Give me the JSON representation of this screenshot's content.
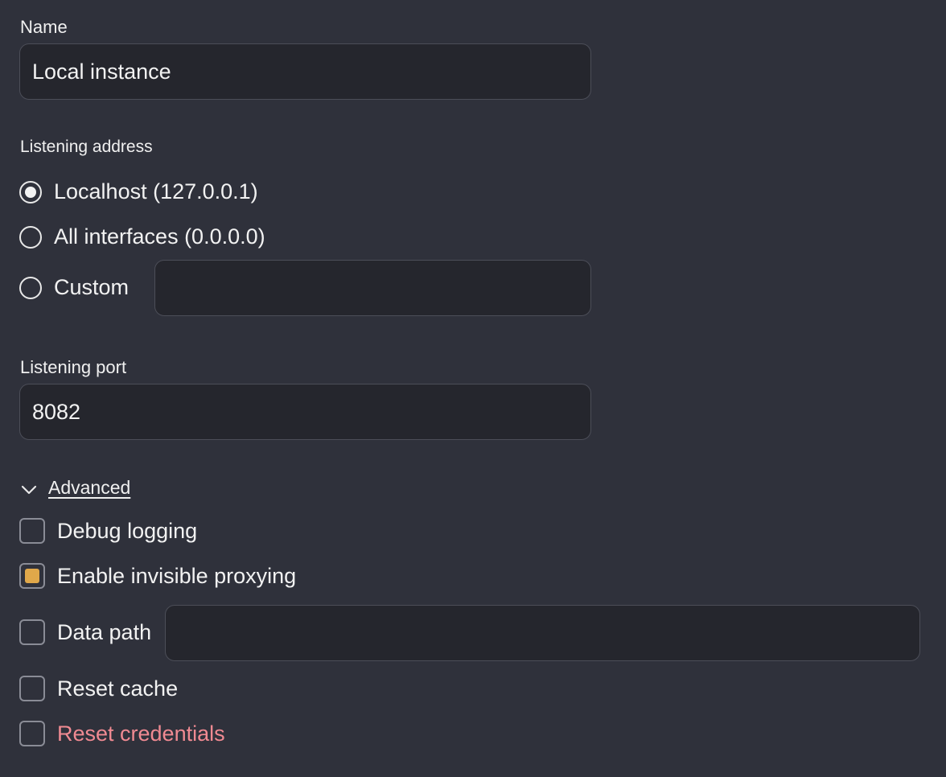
{
  "name_section": {
    "label": "Name",
    "value": "Local instance",
    "placeholder": ""
  },
  "listening_address": {
    "label": "Listening address",
    "options": [
      {
        "label": "Localhost (127.0.0.1)",
        "checked": true
      },
      {
        "label": "All interfaces (0.0.0.0)",
        "checked": false
      },
      {
        "label": "Custom",
        "checked": false
      }
    ],
    "custom_value": ""
  },
  "listening_port": {
    "label": "Listening port",
    "value": "8082"
  },
  "advanced": {
    "label": "Advanced",
    "expanded": true,
    "icon": "chevron-down-icon",
    "options": [
      {
        "label": "Debug logging",
        "checked": false
      },
      {
        "label": "Enable invisible proxying",
        "checked": true
      },
      {
        "label": "Data path",
        "checked": false
      },
      {
        "label": "Reset cache",
        "checked": false
      },
      {
        "label": "Reset credentials",
        "checked": false
      }
    ],
    "data_path_value": ""
  },
  "colors": {
    "background": "#2f313b",
    "field_background": "#25262d",
    "accent": "#e0a84a",
    "danger": "#f08a92"
  }
}
